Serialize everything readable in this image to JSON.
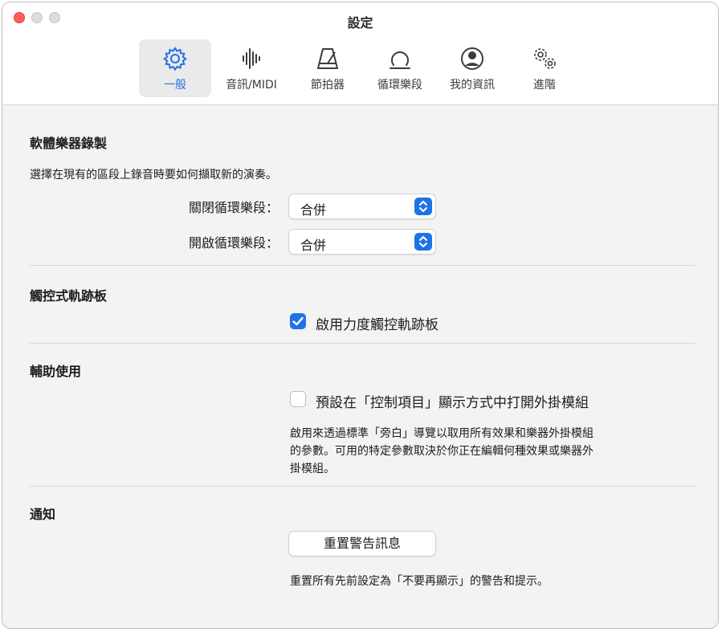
{
  "window": {
    "title": "設定"
  },
  "tabs": [
    {
      "label": "一般",
      "icon": "gear-icon",
      "active": true
    },
    {
      "label": "音訊/MIDI",
      "icon": "waveform-icon",
      "active": false
    },
    {
      "label": "節拍器",
      "icon": "metronome-icon",
      "active": false
    },
    {
      "label": "循環樂段",
      "icon": "loop-icon",
      "active": false
    },
    {
      "label": "我的資訊",
      "icon": "person-circle-icon",
      "active": false
    },
    {
      "label": "進階",
      "icon": "gears-icon",
      "active": false
    }
  ],
  "software_recording": {
    "title": "軟體樂器錄製",
    "description": "選擇在現有的區段上錄音時要如何擷取新的演奏。",
    "loop_off_label": "關閉循環樂段：",
    "loop_off_value": "合併",
    "loop_on_label": "開啟循環樂段：",
    "loop_on_value": "合併"
  },
  "trackpad": {
    "title": "觸控式軌跡板",
    "force_touch_label": "啟用力度觸控軌跡板",
    "force_touch_checked": true
  },
  "accessibility": {
    "title": "輔助使用",
    "open_plugins_label": "預設在「控制項目」顯示方式中打開外掛模組",
    "open_plugins_checked": false,
    "help_lines": [
      "啟用來透過標準「旁白」導覽以取用所有效果和樂器外掛模組",
      "的參數。可用的特定參數取決於你正在編輯何種效果或樂器外",
      "掛模組。"
    ]
  },
  "notifications": {
    "title": "通知",
    "reset_button": "重置警告訊息",
    "reset_help": "重置所有先前設定為「不要再顯示」的警告和提示。"
  },
  "colors": {
    "accent": "#1f73e6",
    "close": "#ff5f57"
  }
}
